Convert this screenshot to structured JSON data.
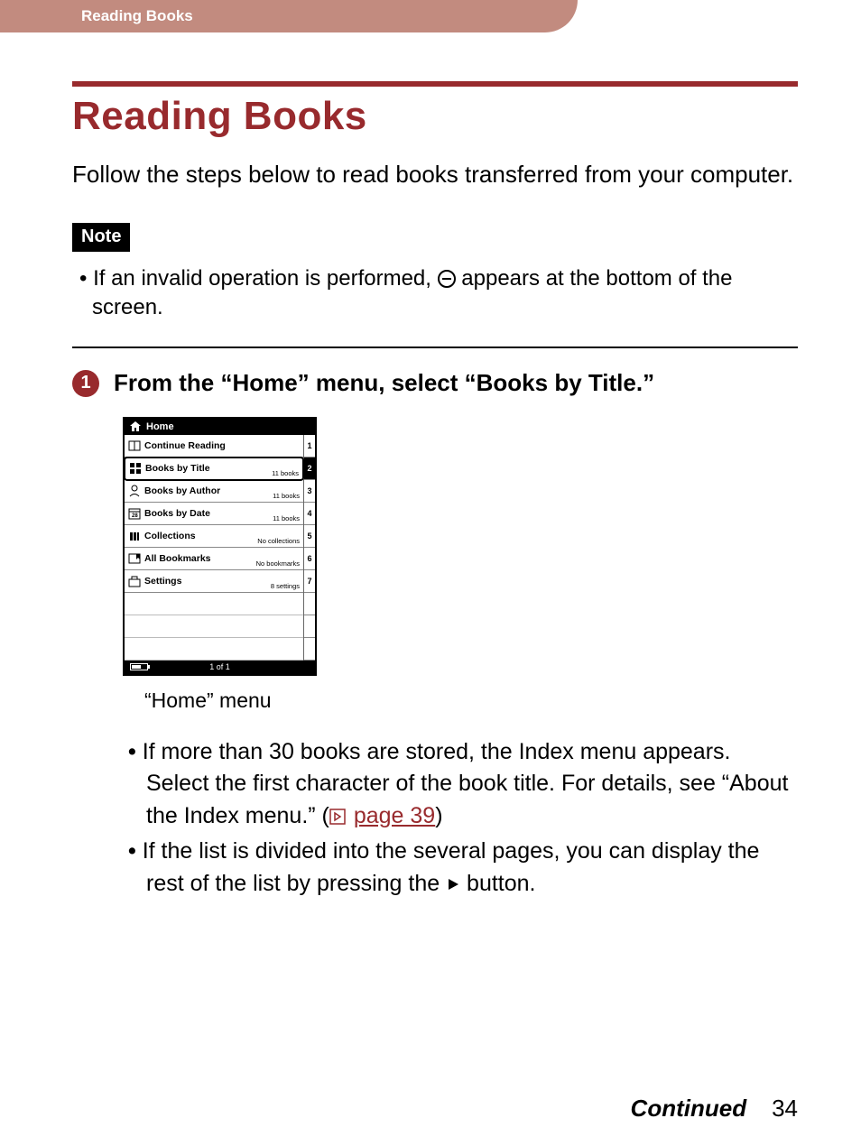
{
  "header": {
    "breadcrumb": "Reading Books"
  },
  "title": "Reading Books",
  "intro": "Follow the steps below to read books transferred from your computer.",
  "note_label": "Note",
  "note_items": [
    {
      "pre": "If an invalid operation is performed, ",
      "post": " appears at the bottom of the screen."
    }
  ],
  "step1": {
    "number": "1",
    "text": "From the “Home” menu, select “Books by Title.”"
  },
  "device": {
    "title": "Home",
    "rows": [
      {
        "label": "Continue Reading",
        "meta": "",
        "num": "1",
        "selected": false
      },
      {
        "label": "Books by Title",
        "meta": "11 books",
        "num": "2",
        "selected": true
      },
      {
        "label": "Books by Author",
        "meta": "11 books",
        "num": "3",
        "selected": false
      },
      {
        "label": "Books by Date",
        "meta": "11 books",
        "num": "4",
        "selected": false
      },
      {
        "label": "Collections",
        "meta": "No collections",
        "num": "5",
        "selected": false
      },
      {
        "label": "All Bookmarks",
        "meta": "No bookmarks",
        "num": "6",
        "selected": false
      },
      {
        "label": "Settings",
        "meta": "8 settings",
        "num": "7",
        "selected": false
      }
    ],
    "page_indicator": "1 of 1"
  },
  "caption": "“Home” menu",
  "body_bullets": [
    {
      "pre": "If more than 30 books are stored, the Index menu appears. Select the first character of the book title. For details, see “About the Index menu.” (",
      "link": "page 39",
      "post": ")"
    },
    {
      "pre": "If the list is divided into the several pages, you can display the rest of the list by pressing the ",
      "post_icon": "play",
      "post2": " button."
    }
  ],
  "footer": {
    "continued": "Continued",
    "page": "34"
  }
}
